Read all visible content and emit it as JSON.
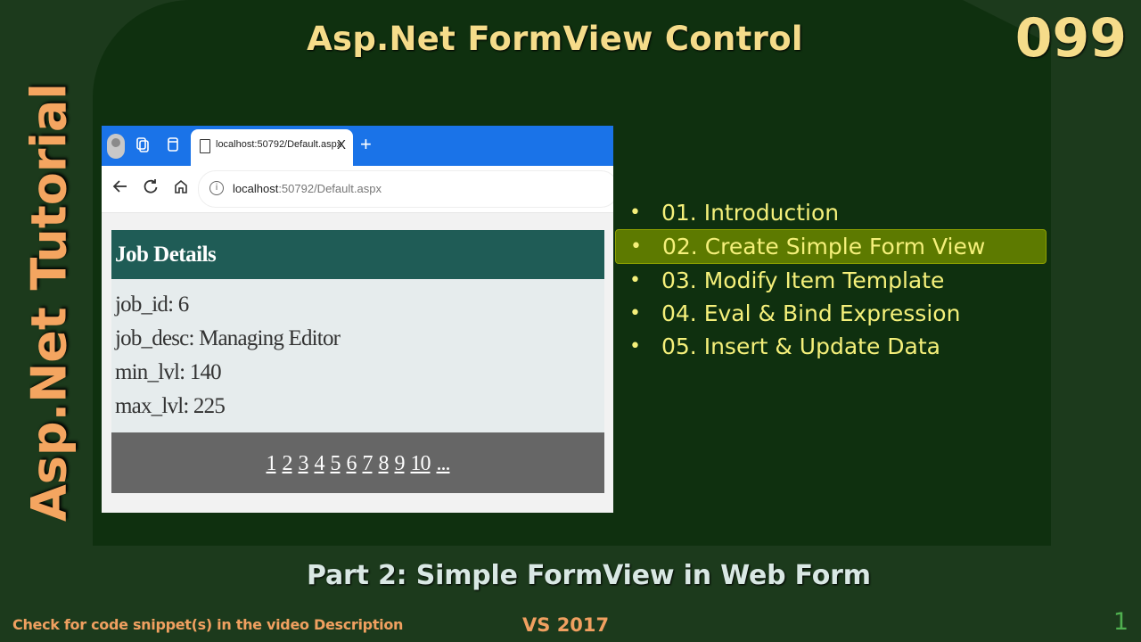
{
  "slide": {
    "title": "Asp.Net FormView Control",
    "episode": "099",
    "series": "Asp.Net Tutorial",
    "subtitle": "Part 2: Simple FormView in Web Form",
    "footer_note": "Check for code snippet(s) in the video Description",
    "footer_version": "VS 2017",
    "slide_number": "1"
  },
  "browser": {
    "tab_title": "localhost:50792/Default.aspx",
    "tab_close": "X",
    "new_tab": "+",
    "url_host": "localhost",
    "url_path": ":50792/Default.aspx",
    "icons": [
      "profile-avatar-icon",
      "workspaces-icon",
      "tab-actions-icon",
      "page-icon",
      "back-icon",
      "refresh-icon",
      "home-icon",
      "info-icon"
    ]
  },
  "formview": {
    "header": "Job Details",
    "rows": [
      {
        "label": "job_id: 6"
      },
      {
        "label": "job_desc: Managing Editor"
      },
      {
        "label": "min_lvl: 140"
      },
      {
        "label": "max_lvl: 225"
      }
    ],
    "pager": [
      "1",
      "2",
      "3",
      "4",
      "5",
      "6",
      "7",
      "8",
      "9",
      "10",
      "..."
    ]
  },
  "topics": [
    {
      "label": "01. Introduction",
      "active": false
    },
    {
      "label": "02. Create Simple Form View",
      "active": true
    },
    {
      "label": "03. Modify Item Template",
      "active": false
    },
    {
      "label": "04. Eval & Bind Expression",
      "active": false
    },
    {
      "label": "05. Insert & Update Data",
      "active": false
    }
  ],
  "colors": {
    "background": "#1c3a1c",
    "board": "#0f300f",
    "title_gold": "#f5dc8a",
    "series_orange": "#f4a560",
    "topic_yellow": "#f5f07a",
    "active_topic": "#5d7a00",
    "formview_header": "#1f5c56",
    "pager_gray": "#666666"
  }
}
